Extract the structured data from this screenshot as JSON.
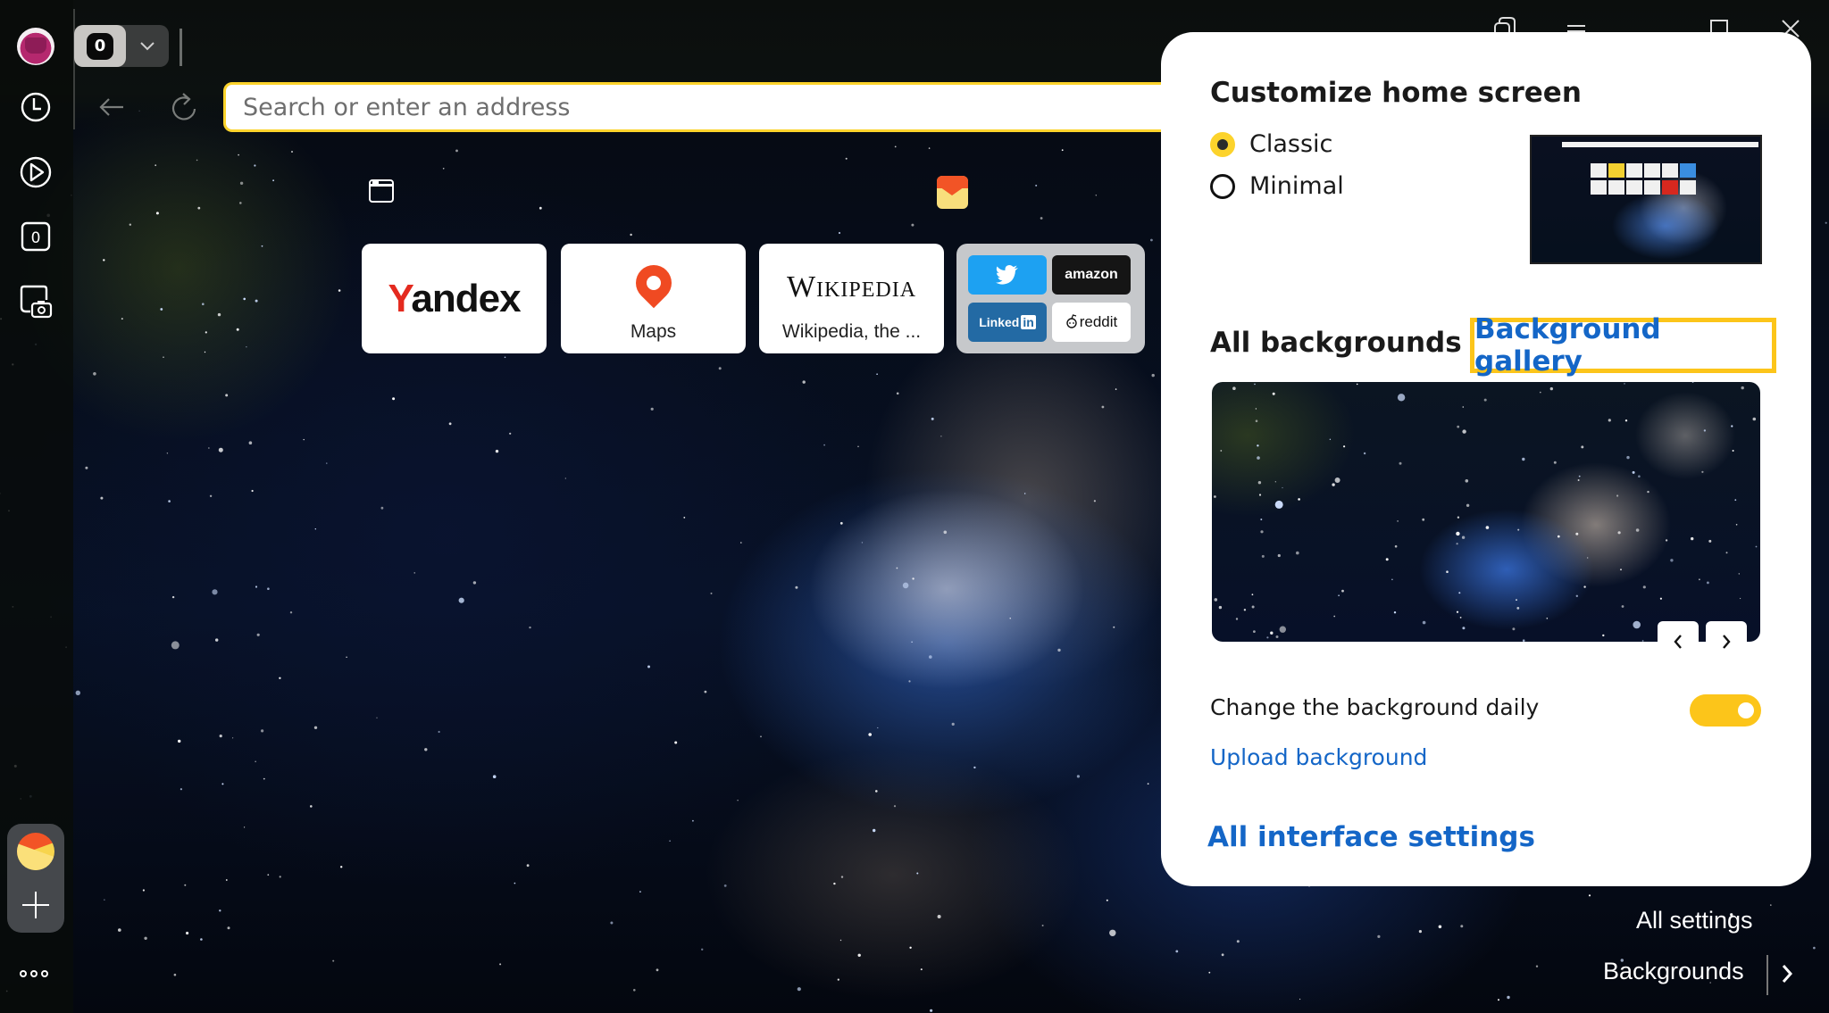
{
  "browser": {
    "tab_count": "0",
    "address_placeholder": "Search or enter an address",
    "sidebar": {
      "icons": [
        "avatar",
        "history-clock-icon",
        "play-icon",
        "tab-counter-icon",
        "screenshot-camera-icon"
      ],
      "tab_counter_value": "0",
      "pinned_app": "yandex-mail-icon",
      "add_label": "+",
      "more_label": "more-dots-icon"
    },
    "window_controls": [
      "collections-icon",
      "menu-icon",
      "maximize-icon",
      "close-icon"
    ]
  },
  "home": {
    "tiles": [
      {
        "name": "yandex",
        "logo_first": "Y",
        "logo_rest": "andex",
        "label": ""
      },
      {
        "name": "maps",
        "label": "Maps"
      },
      {
        "name": "wikipedia",
        "logo": "Wikipedia",
        "label": "Wikipedia, the ..."
      },
      {
        "name": "group",
        "items": [
          {
            "name": "twitter",
            "label": ""
          },
          {
            "name": "amazon",
            "label": "amazon"
          },
          {
            "name": "linkedin",
            "label": "Linked",
            "label_box": "in"
          },
          {
            "name": "reddit",
            "label": "reddit"
          }
        ]
      }
    ],
    "all_settings_label": "All settings",
    "backgrounds_label": "Backgrounds"
  },
  "panel": {
    "title": "Customize home screen",
    "layout_options": [
      {
        "label": "Classic",
        "checked": true
      },
      {
        "label": "Minimal",
        "checked": false
      }
    ],
    "all_backgrounds_label": "All backgrounds",
    "gallery_label": "Background gallery",
    "change_daily_label": "Change the background daily",
    "change_daily_on": true,
    "upload_label": "Upload background",
    "interface_settings_label": "All interface settings"
  },
  "colors": {
    "accent_yellow": "#fcc51a",
    "link_blue": "#1466c7",
    "yandex_red": "#e42a1f"
  }
}
